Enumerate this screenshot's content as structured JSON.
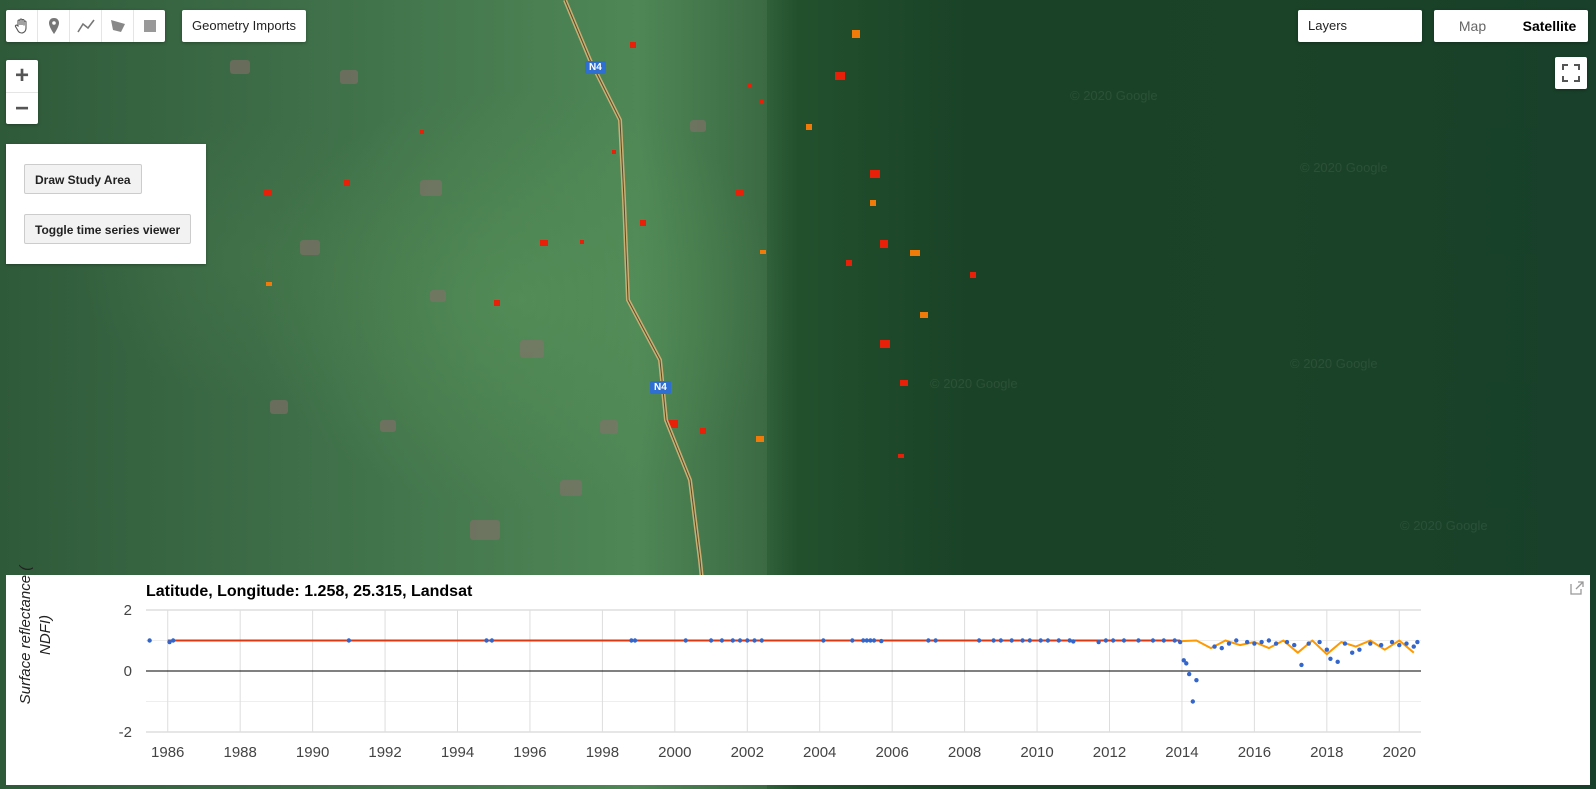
{
  "toolbar": {
    "tools": [
      {
        "name": "pan-hand-icon"
      },
      {
        "name": "marker-icon"
      },
      {
        "name": "line-icon"
      },
      {
        "name": "polygon-icon"
      },
      {
        "name": "rectangle-icon"
      }
    ],
    "geometry_imports_label": "Geometry Imports"
  },
  "zoom": {
    "in_label": "+",
    "out_label": "−"
  },
  "panel": {
    "draw_label": "Draw Study Area",
    "toggle_label": "Toggle time series viewer"
  },
  "layers_label": "Layers",
  "map_type": {
    "map_label": "Map",
    "satellite_label": "Satellite"
  },
  "map": {
    "road_shield": "N4",
    "watermark": "© 2020 Google"
  },
  "chart_data": {
    "type": "scatter",
    "title": "Latitude, Longitude: 1.258, 25.315, Landsat",
    "ylabel": "Surface reflectance ( NDFI)",
    "xlabel": "",
    "xlim": [
      1985.4,
      2020.6
    ],
    "ylim": [
      -2,
      2
    ],
    "yticks": [
      2,
      0,
      -2
    ],
    "xticks": [
      1986,
      1988,
      1990,
      1992,
      1994,
      1996,
      1998,
      2000,
      2002,
      2004,
      2006,
      2008,
      2010,
      2012,
      2014,
      2016,
      2018,
      2020
    ],
    "grid": true,
    "colors": {
      "points": "#3366cc",
      "fit": "#ff9900",
      "model": "#dc3912",
      "zero": "#000000"
    },
    "series": [
      {
        "kind": "points",
        "x": [
          1985.5,
          1986.05,
          1986.15,
          1991.0,
          1994.8,
          1994.95,
          1998.8,
          1998.9,
          2000.3,
          2001.0,
          2001.3,
          2001.6,
          2001.8,
          2002.0,
          2002.2,
          2002.4,
          2004.1,
          2004.9,
          2005.2,
          2005.3,
          2005.4,
          2005.5,
          2005.7,
          2007.0,
          2007.2,
          2008.4,
          2008.8,
          2009.0,
          2009.3,
          2009.6,
          2009.8,
          2010.1,
          2010.3,
          2010.6,
          2010.9,
          2011.0,
          2011.7,
          2011.9,
          2012.1,
          2012.4,
          2012.8,
          2013.2,
          2013.5,
          2013.8,
          2013.95,
          2014.05,
          2014.12,
          2014.2,
          2014.3,
          2014.4,
          2014.9,
          2015.1,
          2015.3,
          2015.5,
          2015.8,
          2016.0,
          2016.2,
          2016.4,
          2016.6,
          2016.9,
          2017.1,
          2017.3,
          2017.5,
          2017.8,
          2018.0,
          2018.1,
          2018.3,
          2018.5,
          2018.7,
          2018.9,
          2019.2,
          2019.5,
          2019.8,
          2020.0,
          2020.2,
          2020.4,
          2020.5
        ],
        "y": [
          1.0,
          0.95,
          1.0,
          1.0,
          1.0,
          1.0,
          1.0,
          1.0,
          1.0,
          1.0,
          1.0,
          1.0,
          1.0,
          1.0,
          1.0,
          1.0,
          1.0,
          1.0,
          1.0,
          1.0,
          1.0,
          1.0,
          0.98,
          1.0,
          1.0,
          1.0,
          1.0,
          1.0,
          1.0,
          1.0,
          1.0,
          1.0,
          1.0,
          1.0,
          1.0,
          0.97,
          0.95,
          1.0,
          1.0,
          1.0,
          1.0,
          1.0,
          1.0,
          1.0,
          0.95,
          0.35,
          0.25,
          -0.1,
          -1.0,
          -0.3,
          0.8,
          0.75,
          0.9,
          1.0,
          0.95,
          0.9,
          0.95,
          1.0,
          0.9,
          0.95,
          0.85,
          0.2,
          0.9,
          0.95,
          0.7,
          0.4,
          0.3,
          0.9,
          0.6,
          0.7,
          0.9,
          0.85,
          0.95,
          0.85,
          0.9,
          0.8,
          0.95
        ]
      },
      {
        "kind": "model",
        "x": [
          1986.0,
          2013.95
        ],
        "y": [
          1.0,
          1.0
        ]
      },
      {
        "kind": "fit",
        "x": [
          2014.0,
          2014.4,
          2014.8,
          2015.2,
          2015.6,
          2016.0,
          2016.4,
          2016.8,
          2017.2,
          2017.6,
          2018.0,
          2018.4,
          2018.8,
          2019.2,
          2019.6,
          2020.0,
          2020.4
        ],
        "y": [
          0.98,
          1.0,
          0.75,
          1.0,
          0.85,
          0.95,
          0.75,
          1.0,
          0.6,
          1.0,
          0.55,
          0.95,
          0.8,
          1.0,
          0.7,
          1.0,
          0.6
        ]
      }
    ]
  }
}
